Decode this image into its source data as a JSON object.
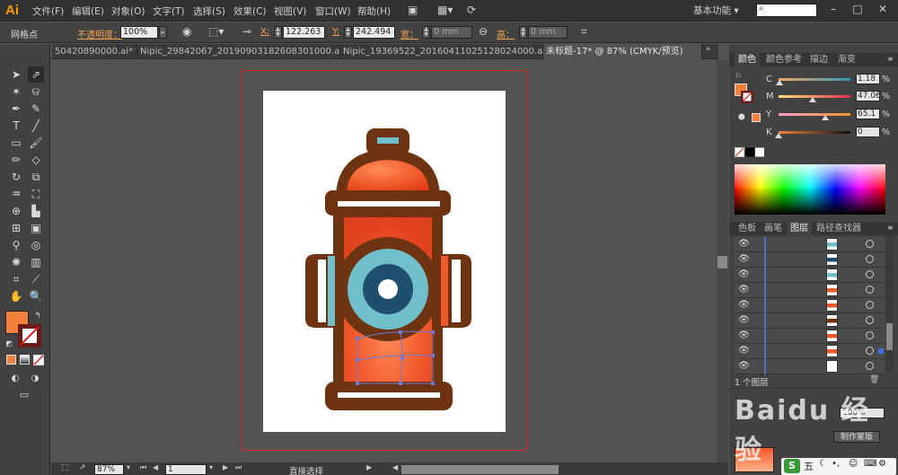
{
  "app": {
    "logo": "Ai",
    "workspace": "基本功能",
    "search_icon": "⌕"
  },
  "menu": [
    {
      "label": "文件(F)"
    },
    {
      "label": "编辑(E)"
    },
    {
      "label": "对象(O)"
    },
    {
      "label": "文字(T)"
    },
    {
      "label": "选择(S)"
    },
    {
      "label": "效果(C)"
    },
    {
      "label": "视图(V)"
    },
    {
      "label": "窗口(W)"
    },
    {
      "label": "帮助(H)"
    }
  ],
  "control": {
    "tool_name": "网格点",
    "opacity_label": "不透明度：",
    "opacity_value": "100%",
    "x_label": "X:",
    "x_value": "122.263",
    "y_label": "Y:",
    "y_value": "242.494",
    "w_label": "宽：",
    "w_value": "0 mm",
    "h_label": "高：",
    "h_value": "0 mm"
  },
  "tabs": [
    {
      "label": "50420890000.ai* ×"
    },
    {
      "label": "Nipic_29842067_20190903182608301000.ai* ×"
    },
    {
      "label": "Nipic_19369522_20160411025128024000.ai* ×"
    },
    {
      "label": "未标题-17* @ 87% (CMYK/预览)"
    }
  ],
  "color_panel": {
    "tabs": [
      {
        "label": "颜色"
      },
      {
        "label": "颜色参考"
      },
      {
        "label": "描边"
      },
      {
        "label": "渐变"
      }
    ],
    "channels": [
      {
        "label": "C",
        "value": "1.18"
      },
      {
        "label": "M",
        "value": "47.06"
      },
      {
        "label": "Y",
        "value": "65.1"
      },
      {
        "label": "K",
        "value": "0"
      }
    ],
    "channel_levels": [
      0.012,
      0.47,
      0.65,
      0.0
    ],
    "pct": "%"
  },
  "layers_panel": {
    "tabs": [
      {
        "label": "色板"
      },
      {
        "label": "画笔"
      },
      {
        "label": "图层"
      },
      {
        "label": "路径查找器"
      }
    ],
    "count_label": "1 个图层",
    "make_mask_label": "制作蒙版",
    "row_count_visible": 9
  },
  "status": {
    "zoom": "87%",
    "page": "1",
    "tool": "直接选择"
  },
  "watermark": "Baidu 经验",
  "colors": {
    "fill": "#f3813b",
    "accent": "#ff9a00",
    "hydrant_dark": "#6e3411",
    "hydrant_orange": "#f04a1f",
    "hydrant_teal": "#6fc0cc",
    "hydrant_navy": "#1f4f6e"
  }
}
